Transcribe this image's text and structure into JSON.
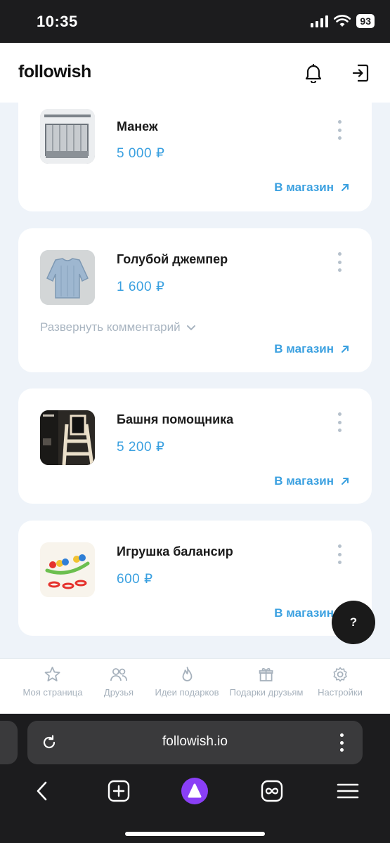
{
  "status": {
    "time": "10:35",
    "battery": "93"
  },
  "header": {
    "logo": "followish"
  },
  "items": [
    {
      "title": "Манеж",
      "price": "5 000 ₽",
      "shop_label": "В магазин"
    },
    {
      "title": "Голубой джемпер",
      "price": "1 600 ₽",
      "expand_label": "Развернуть комментарий",
      "shop_label": "В магазин"
    },
    {
      "title": "Башня помощника",
      "price": "5 200 ₽",
      "shop_label": "В магазин"
    },
    {
      "title": "Игрушка балансир",
      "price": "600 ₽",
      "shop_label": "В магазин"
    }
  ],
  "help": {
    "label": "?"
  },
  "tabs": [
    {
      "label": "Моя страница",
      "icon": "star-icon"
    },
    {
      "label": "Друзья",
      "icon": "users-icon"
    },
    {
      "label": "Идеи подарков",
      "icon": "flame-icon"
    },
    {
      "label": "Подарки друзьям",
      "icon": "gift-icon"
    },
    {
      "label": "Настройки",
      "icon": "gear-icon"
    }
  ],
  "browser": {
    "url": "followish.io"
  },
  "colors": {
    "accent": "#3aa0e0",
    "muted": "#a6b1bc",
    "background": "#eef3f9",
    "dark": "#1c1c1e"
  }
}
